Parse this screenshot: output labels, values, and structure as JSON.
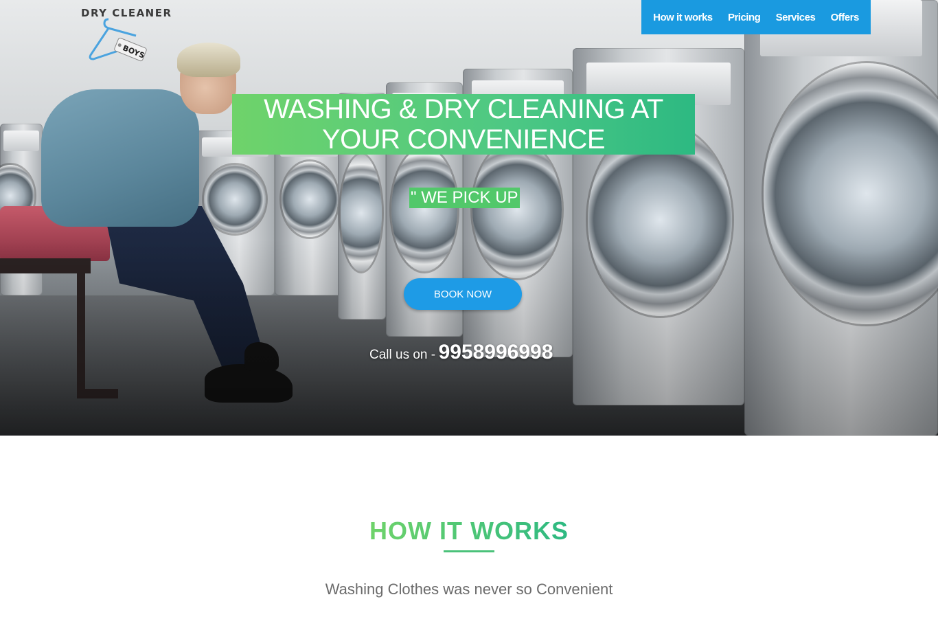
{
  "logo": {
    "name": "Dry Cleaner",
    "tag": "BOYS"
  },
  "nav": {
    "items": [
      {
        "label": "How it works"
      },
      {
        "label": "Pricing"
      },
      {
        "label": "Services"
      },
      {
        "label": "Offers"
      }
    ],
    "background": "#1a9ae0"
  },
  "hero": {
    "headline": "WASHING & DRY CLEANING AT YOUR CONVENIENCE",
    "tagline": "\" WE PICK UP",
    "book_label": "BOOK NOW",
    "call_label": "Call us on -",
    "phone": "9958996998"
  },
  "how_it_works": {
    "title": "HOW IT WORKS",
    "subtitle": "Washing Clothes was never so Convenient"
  },
  "colors": {
    "accent_green": "#4bc27a",
    "button_blue": "#1e9be6"
  }
}
